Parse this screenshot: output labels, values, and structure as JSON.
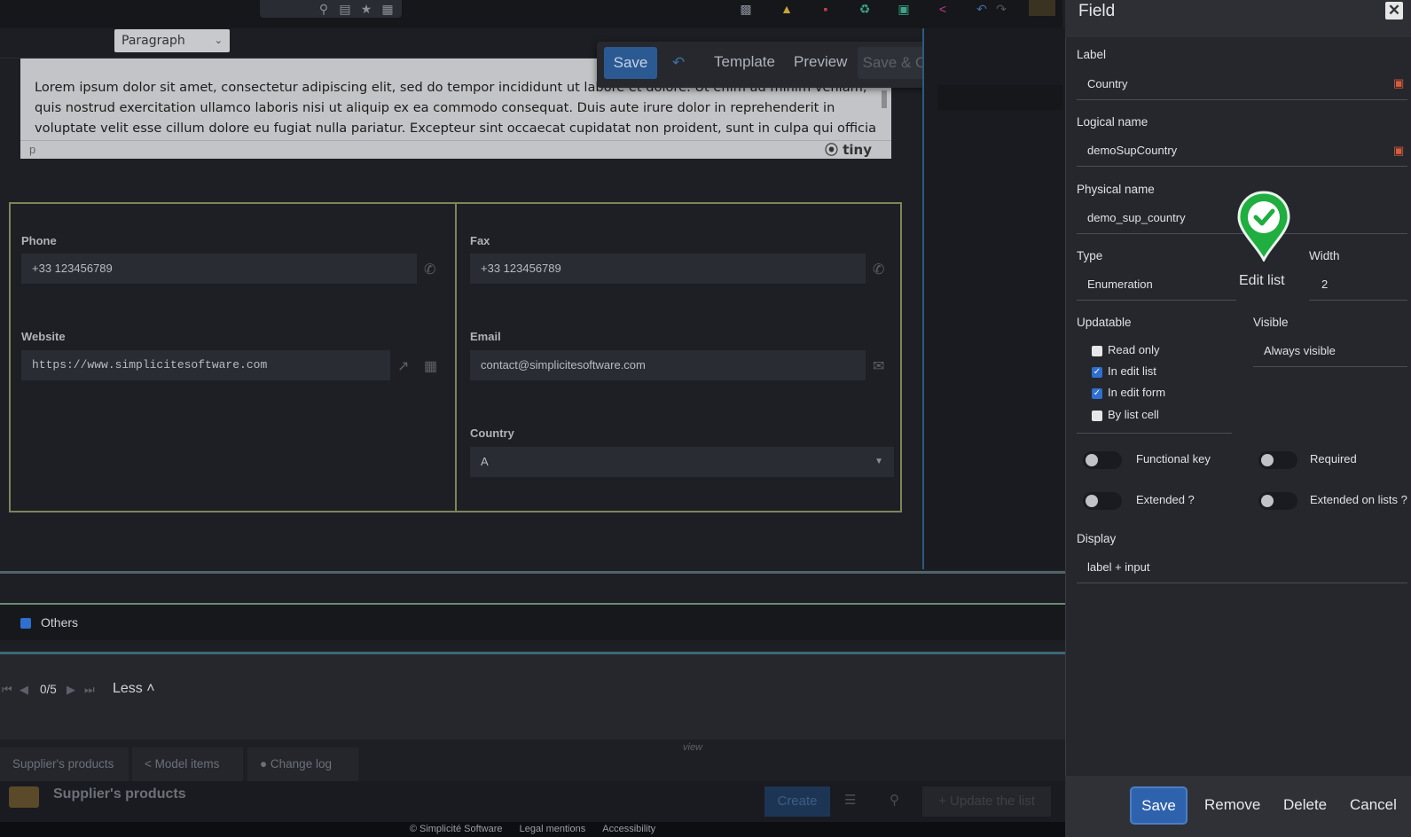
{
  "toolbar": {
    "paragraph_select": "Paragraph",
    "save": "Save",
    "template": "Template",
    "preview": "Preview",
    "save_close": "Save & Close"
  },
  "editor": {
    "text": "Lorem ipsum dolor sit amet, consectetur adipiscing elit, sed do tempor incididunt ut labore et dolore. Ut enim ad minim veniam, quis nostrud exercitation ullamco laboris nisi ut aliquip ex ea commodo consequat. Duis aute irure dolor in reprehenderit in voluptate velit esse cillum dolore eu fugiat nulla pariatur. Excepteur sint occaecat cupidatat non proident, sunt in culpa qui officia",
    "status_path": "p",
    "logo": "tiny"
  },
  "form": {
    "phone": {
      "label": "Phone",
      "value": "+33 123456789"
    },
    "fax": {
      "label": "Fax",
      "value": "+33 123456789"
    },
    "website": {
      "label": "Website",
      "value": "https://www.simplicitesoftware.com"
    },
    "email": {
      "label": "Email",
      "value": "contact@simplicitesoftware.com"
    },
    "country": {
      "label": "Country",
      "value": "A"
    }
  },
  "others_label": "Others",
  "pager": {
    "count": "0/5",
    "less": "Less"
  },
  "tabs": [
    {
      "label": "Supplier's products"
    },
    {
      "label": "Model items"
    },
    {
      "label": "Change log"
    }
  ],
  "view_label": "view",
  "suppliers_products_title": "Supplier's products",
  "list_actions": {
    "create": "Create",
    "update_list": "Update the list"
  },
  "footer": {
    "copyright": "© Simplicité Software",
    "legal": "Legal mentions",
    "accessibility": "Accessibility"
  },
  "drawer": {
    "title": "Field",
    "label": {
      "label": "Label",
      "value": "Country"
    },
    "logical_name": {
      "label": "Logical name",
      "value": "demoSupCountry"
    },
    "physical_name": {
      "label": "Physical name",
      "value": "demo_sup_country"
    },
    "type": {
      "label": "Type",
      "value": "Enumeration"
    },
    "edit_list": "Edit list",
    "width": {
      "label": "Width",
      "value": "2"
    },
    "updatable": {
      "label": "Updatable",
      "options": [
        {
          "label": "Read only",
          "checked": false
        },
        {
          "label": "In edit list",
          "checked": true
        },
        {
          "label": "In edit form",
          "checked": true
        },
        {
          "label": "By list cell",
          "checked": false
        }
      ]
    },
    "visible": {
      "label": "Visible",
      "value": "Always visible"
    },
    "toggles": {
      "functional_key": "Functional key",
      "required": "Required",
      "extended": "Extended ?",
      "extended_lists": "Extended on lists ?"
    },
    "display": {
      "label": "Display",
      "value": "label + input"
    },
    "buttons": {
      "save": "Save",
      "remove": "Remove",
      "delete": "Delete",
      "cancel": "Cancel"
    }
  },
  "colors": {
    "accent": "#2e62ad",
    "group_border": "#7d8559",
    "pin": "#1fae3f"
  }
}
